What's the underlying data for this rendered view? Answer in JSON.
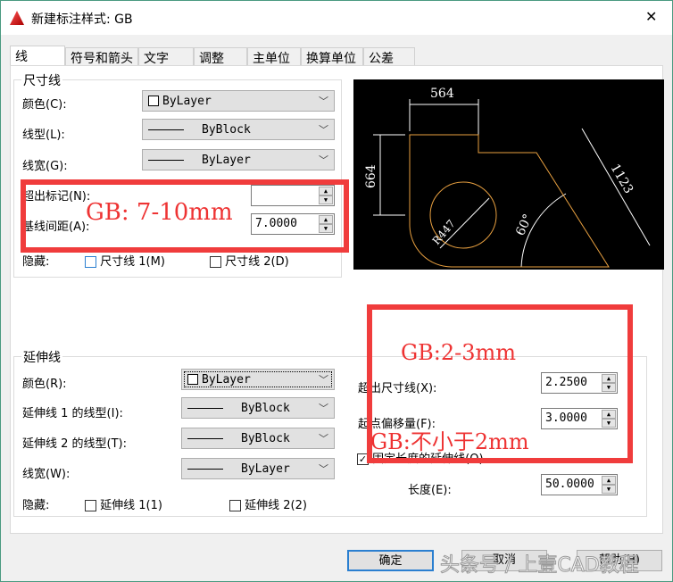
{
  "window": {
    "title": "新建标注样式: GB",
    "close": "✕"
  },
  "tabs": [
    "线",
    "符号和箭头",
    "文字",
    "调整",
    "主单位",
    "换算单位",
    "公差"
  ],
  "dim_lines": {
    "group": "尺寸线",
    "color_label": "颜色(C):",
    "color_value": "ByLayer",
    "linetype_label": "线型(L):",
    "linetype_value": "ByBlock",
    "lineweight_label": "线宽(G):",
    "lineweight_value": "ByLayer",
    "extend_label": "超出标记(N):",
    "extend_value": "",
    "baseline_label": "基线间距(A):",
    "baseline_value": "7.0000",
    "suppress_label": "隐藏:",
    "suppress1": "尺寸线 1(M)",
    "suppress2": "尺寸线 2(D)"
  },
  "ext_lines": {
    "group": "延伸线",
    "color_label": "颜色(R):",
    "color_value": "ByLayer",
    "lt1_label": "延伸线 1 的线型(I):",
    "lt1_value": "ByBlock",
    "lt2_label": "延伸线 2 的线型(T):",
    "lt2_value": "ByBlock",
    "lw_label": "线宽(W):",
    "lw_value": "ByLayer",
    "suppress_label": "隐藏:",
    "suppress1": "延伸线 1(1)",
    "suppress2": "延伸线 2(2)",
    "beyond_label": "超出尺寸线(X):",
    "beyond_value": "2.2500",
    "offset_label": "起点偏移量(F):",
    "offset_value": "3.0000",
    "fixed_label": "固定长度的延伸线(O)",
    "fixed_checked": true,
    "length_label": "长度(E):",
    "length_value": "50.0000"
  },
  "preview": {
    "dim_top": "564",
    "dim_left": "664",
    "dim_diag": "1123",
    "radius": "R447",
    "angle": "60°"
  },
  "annotations": {
    "note1": "GB: 7-10mm",
    "note2": "GB:2-3mm",
    "note3": "GB:不小于2mm",
    "watermark": "头条号 / 上壹CAD教程"
  },
  "buttons": {
    "ok": "确定",
    "cancel": "取消",
    "help": "帮助(H)"
  },
  "colors": {
    "annotation": "#f03c3c",
    "preview_shape": "#e8a040"
  }
}
